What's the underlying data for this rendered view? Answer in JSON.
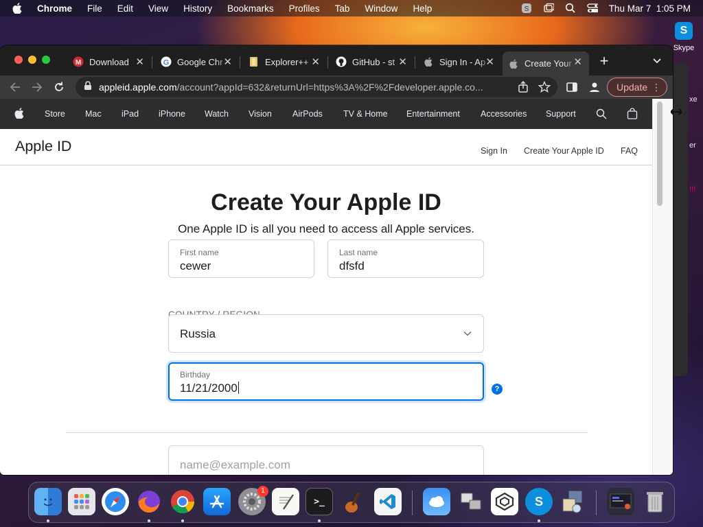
{
  "menubar": {
    "app_name": "Chrome",
    "items": [
      "File",
      "Edit",
      "View",
      "History",
      "Bookmarks",
      "Profiles",
      "Tab",
      "Window",
      "Help"
    ],
    "clock": "Thu Mar 7  1:05 PM"
  },
  "desktop": {
    "skype_label": "Skype",
    "fragments": [
      "xe",
      "er",
      "!!!"
    ]
  },
  "browser": {
    "tabs": [
      {
        "label": "Download",
        "icon": "mega-icon"
      },
      {
        "label": "Google Chr",
        "icon": "google-icon"
      },
      {
        "label": "Explorer++",
        "icon": "folder-icon"
      },
      {
        "label": "GitHub - st",
        "icon": "github-icon"
      },
      {
        "label": "Sign In - Ap",
        "icon": "apple-icon"
      },
      {
        "label": "Create Your",
        "icon": "apple-icon"
      }
    ],
    "url_host": "appleid.apple.com",
    "url_path": "/account?appId=632&returnUrl=https%3A%2F%2Fdeveloper.apple.co...",
    "update_label": "Update"
  },
  "globalnav": {
    "items": [
      "Store",
      "Mac",
      "iPad",
      "iPhone",
      "Watch",
      "Vision",
      "AirPods",
      "TV & Home",
      "Entertainment",
      "Accessories",
      "Support"
    ]
  },
  "localnav": {
    "brand": "Apple ID",
    "links": [
      "Sign In",
      "Create Your Apple ID",
      "FAQ"
    ]
  },
  "form": {
    "title": "Create Your Apple ID",
    "subtitle": "One Apple ID is all you need to access all Apple services.",
    "first_name_label": "First name",
    "first_name_value": "cewer",
    "last_name_label": "Last name",
    "last_name_value": "dfsfd",
    "country_label": "COUNTRY / REGION",
    "country_value": "Russia",
    "birthday_label": "Birthday",
    "birthday_value": "11/21/2000",
    "help_glyph": "?",
    "email_placeholder": "name@example.com"
  },
  "dock": {
    "badge_count": "1",
    "apps": [
      "Finder",
      "Launchpad",
      "Safari",
      "Firefox",
      "Chrome",
      "App Store",
      "System Settings",
      "TextEdit",
      "Terminal",
      "GarageBand",
      "VS Code",
      "Weather",
      "Migration Assistant",
      "Parallels",
      "Skype",
      "Installer",
      "Screenshot",
      "Trash"
    ]
  },
  "colors": {
    "accent": "#0071e3",
    "globalnav_bg": "#2d2d2f"
  }
}
